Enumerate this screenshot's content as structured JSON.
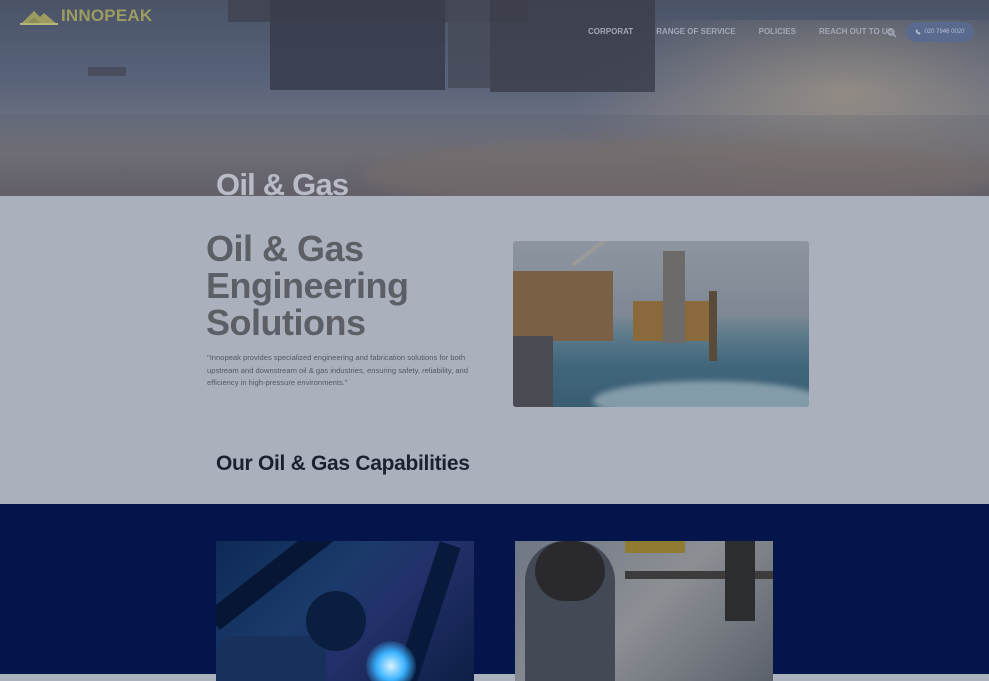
{
  "brand": {
    "name": "INNOPEAK"
  },
  "nav": {
    "items": [
      "CORPORAT",
      "RANGE OF SERVICE",
      "POLICIES",
      "REACH OUT TO US"
    ],
    "search_icon": "search-icon",
    "phone_label": "020 7946 0020",
    "phone_icon": "phone-icon"
  },
  "hero": {
    "title": "Oil & Gas"
  },
  "about": {
    "heading_lines": [
      "Oil & Gas",
      "Engineering",
      "Solutions"
    ],
    "paragraph": "\"Innopeak provides specialized engineering and fabrication solutions for both upstream and downstream oil & gas industries, ensuring safety, reliability, and efficiency in high-pressure environments.\""
  },
  "capabilities": {
    "heading": "Our Oil & Gas Capabilities"
  },
  "colors": {
    "brand_accent": "#9c9c60",
    "cards_background": "#03154a",
    "heading_text": "#1c2030"
  }
}
